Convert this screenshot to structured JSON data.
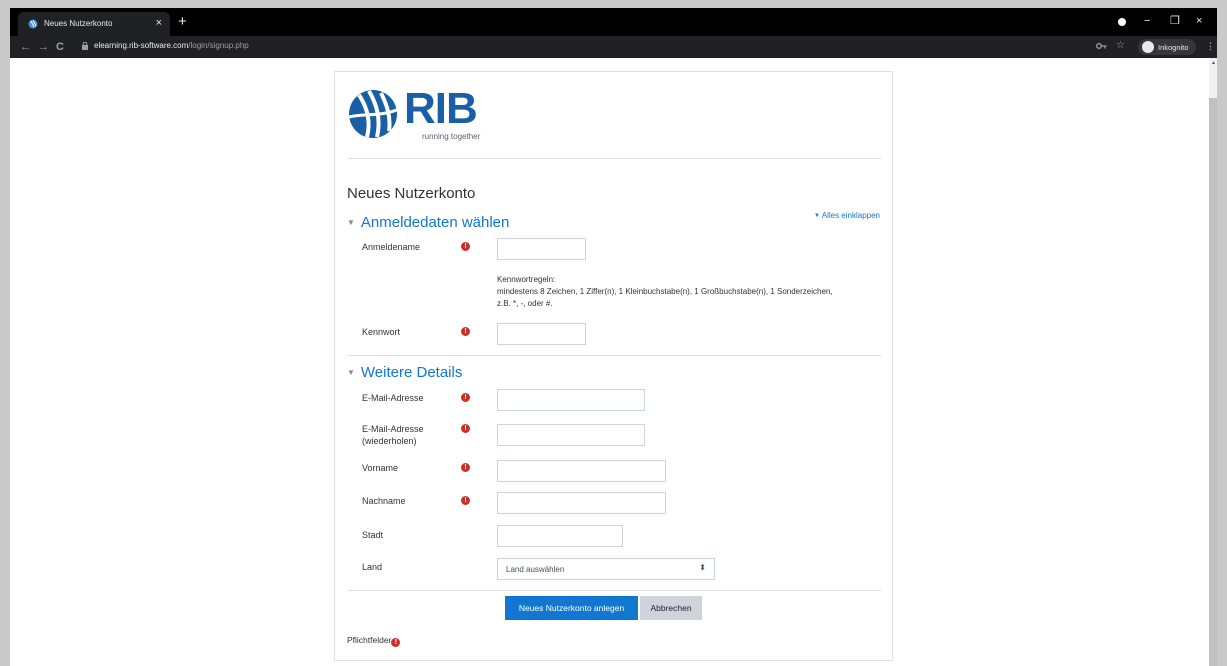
{
  "browser": {
    "tab_title": "Neues Nutzerkonto",
    "tab_close": "×",
    "new_tab": "+",
    "url_host": "elearning.rib-software.com",
    "url_path": "/login/signup.php",
    "incognito_label": "Inkognito",
    "controls": {
      "minimize": "−",
      "restore": "❐",
      "close": "×"
    },
    "nav": {
      "back": "←",
      "forward": "→",
      "reload": "C"
    },
    "icons": {
      "key": "key-icon",
      "star": "star-icon",
      "menu": "kebab-menu-icon"
    }
  },
  "brand": {
    "logo_text": "RIB",
    "tagline": "running together",
    "color": "#1a5ea6"
  },
  "page": {
    "title": "Neues Nutzerkonto",
    "collapse_all": "Alles einklappen"
  },
  "sections": {
    "login": {
      "heading": "Anmeldedaten wählen",
      "username_label": "Anmeldename",
      "password_rules": "Kennwortregeln:",
      "password_rules_detail": "mindestens 8 Zeichen, 1 Ziffer(n), 1 Kleinbuchstabe(n), 1 Großbuchstabe(n), 1 Sonderzeichen, z.B. *, -, oder #.",
      "password_label": "Kennwort"
    },
    "details": {
      "heading": "Weitere Details",
      "email_label": "E-Mail-Adresse",
      "email_repeat_label": "E-Mail-Adresse (wiederholen)",
      "firstname_label": "Vorname",
      "lastname_label": "Nachname",
      "city_label": "Stadt",
      "country_label": "Land",
      "country_selected": "Land auswählen"
    }
  },
  "buttons": {
    "submit": "Neues Nutzerkonto anlegen",
    "cancel": "Abbrechen"
  },
  "required_note": "Pflichtfelder",
  "required_glyph": "!",
  "colors": {
    "accent": "#1177d1",
    "required": "#c9302c"
  }
}
